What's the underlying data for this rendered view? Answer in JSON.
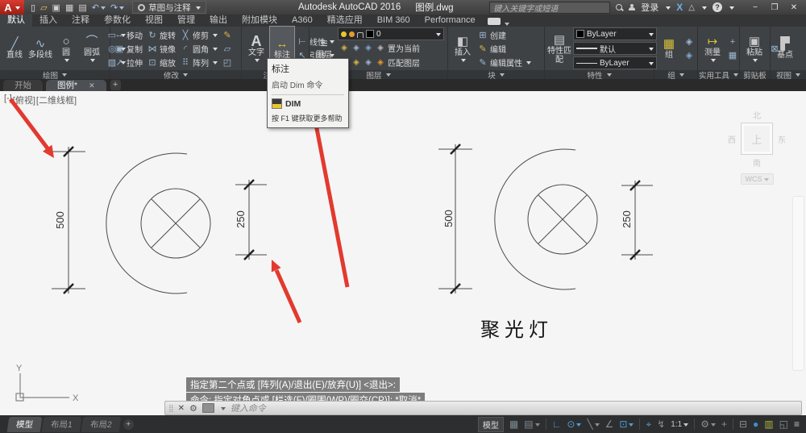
{
  "titlebar": {
    "app_letter": "A",
    "workspace": "草图与注释",
    "app_title": "Autodesk AutoCAD 2016",
    "doc_name": "图例.dwg",
    "search_placeholder": "键入关键字或短语",
    "sign_in": "登录",
    "exchange_x": "X",
    "help_q": "?",
    "minimize": "−",
    "maximize": "❐",
    "close": "✕",
    "qat": [
      {
        "name": "new-file-icon",
        "glyph": "▯",
        "color": "#e8e8e8"
      },
      {
        "name": "open-file-icon",
        "glyph": "▱",
        "color": "#e3c36a"
      },
      {
        "name": "save-icon",
        "glyph": "▣",
        "color": "#cfcfcf"
      },
      {
        "name": "save-as-icon",
        "glyph": "▦",
        "color": "#cfcfcf"
      },
      {
        "name": "plot-icon",
        "glyph": "▤",
        "color": "#cfcfcf"
      },
      {
        "name": "undo-icon",
        "glyph": "↶",
        "color": "#9fc3e8",
        "caret": true
      },
      {
        "name": "redo-icon",
        "glyph": "↷",
        "color": "#9fc3e8",
        "caret": true
      }
    ]
  },
  "ribbon": {
    "tabs": [
      {
        "label": "默认",
        "active": true
      },
      {
        "label": "插入"
      },
      {
        "label": "注释"
      },
      {
        "label": "参数化"
      },
      {
        "label": "视图"
      },
      {
        "label": "管理"
      },
      {
        "label": "输出"
      },
      {
        "label": "附加模块"
      },
      {
        "label": "A360"
      },
      {
        "label": "精选应用"
      },
      {
        "label": "BIM 360"
      },
      {
        "label": "Performance"
      }
    ],
    "icons": {
      "line": "╱",
      "polyline": "∿",
      "circle": "○",
      "arc": "⌒",
      "rect": "▭",
      "ellipse": "◎",
      "hatch": "▨",
      "move": "↔",
      "rotate": "↻",
      "trim": "╳",
      "copy": "▣",
      "mirror": "⋈",
      "fillet": "◜",
      "stretch": "↗",
      "scale": "⊡",
      "array": "⠿",
      "pencil": "✎",
      "box": "▱",
      "poly": "◰",
      "text": "A",
      "dim": "↔",
      "linear": "⊢",
      "leader": "↖",
      "layers": "≡",
      "layer_tool": "◈",
      "insert": "◧",
      "create": "⊞",
      "edit": "✎",
      "edit_attr": "✎",
      "match": "▤",
      "lines": "≡",
      "group": "▦",
      "group_small": "◈",
      "measure": "↦",
      "plus": "+",
      "calc": "▦",
      "paste": "▣",
      "cut": "⊠",
      "base": "▛"
    },
    "panels": {
      "draw": {
        "label": "绘图",
        "line": "直线",
        "polyline": "多段线",
        "circle": "圆",
        "arc": "圆弧"
      },
      "modify": {
        "label": "修改",
        "move": "移动",
        "rotate": "旋转",
        "trim": "修剪",
        "copy": "复制",
        "mirror": "镜像",
        "fillet": "圆角",
        "stretch": "拉伸",
        "scale": "缩放",
        "array": "阵列"
      },
      "annotate": {
        "label": "注释",
        "text": "文字",
        "dim": "标注",
        "linear": "线性",
        "leader": "引线"
      },
      "layers": {
        "label": "图层",
        "layers_btn": "图层",
        "current_layer": "0",
        "set_current": "置为当前",
        "match_layer": "匹配图层"
      },
      "block": {
        "label": "块",
        "insert": "插入",
        "create": "创建",
        "edit": "编辑",
        "edit_attr": "编辑属性"
      },
      "properties": {
        "label": "特性",
        "match_props": "特性匹配",
        "color": "ByLayer",
        "lineweight": "默认",
        "linetype": "ByLayer"
      },
      "groups": {
        "label": "组",
        "group": "组"
      },
      "utilities": {
        "label": "实用工具",
        "measure": "测量"
      },
      "clipboard": {
        "label": "剪贴板",
        "paste": "粘贴"
      },
      "view": {
        "label": "视图",
        "base": "基点"
      }
    }
  },
  "tooltip": {
    "title": "标注",
    "subtitle": "启动 Dim 命令",
    "command": "DIM",
    "help": "按 F1 键获取更多帮助"
  },
  "file_tabs": {
    "start": "开始",
    "doc": "图例*",
    "close": "✕",
    "plus": "+"
  },
  "viewport": {
    "controls": [
      "[-]",
      "[俯视]",
      "[二维线框]"
    ],
    "viewcube": {
      "n": "北",
      "s": "南",
      "e": "东",
      "w": "西",
      "top": "上",
      "wcs": "WCS"
    }
  },
  "drawing": {
    "label": "聚光灯",
    "dim_left_height": "500",
    "dim_left_width": "250",
    "dim_right_height": "500",
    "dim_right_width": "250",
    "ucs_x": "X",
    "ucs_y": "Y",
    "line_color": "#4a4a4a",
    "arrow_color": "#e23a2e"
  },
  "command_line": {
    "history": [
      "指定第二个点或 [阵列(A)/退出(E)/放弃(U)] <退出>:",
      "命令: 指定对角点或 [栏选(F)/圈围(WP)/圈交(CP)]: *取消*"
    ],
    "placeholder": "键入命令"
  },
  "status_bar": {
    "layout_tabs": [
      {
        "label": "模型",
        "active": true
      },
      {
        "label": "布局1"
      },
      {
        "label": "布局2"
      }
    ],
    "plus": "+",
    "model_button": "模型",
    "icons": [
      {
        "name": "grid-icon",
        "glyph": "▦",
        "color": "#7f8b94"
      },
      {
        "name": "snap-mode-icon",
        "glyph": "▤",
        "color": "#7f8b94",
        "caret": true
      },
      {
        "name": "separator"
      },
      {
        "name": "ortho-icon",
        "glyph": "∟",
        "color": "#4f9fd8"
      },
      {
        "name": "polar-tracking-icon",
        "glyph": "⊙",
        "color": "#4f9fd8",
        "caret": true
      },
      {
        "name": "isodraft-icon",
        "glyph": "╲",
        "color": "#8a8f94",
        "caret": true
      },
      {
        "name": "otrack-icon",
        "glyph": "∠",
        "color": "#8a8f94"
      },
      {
        "name": "osnap-icon",
        "glyph": "⊡",
        "color": "#4f9fd8",
        "caret": true
      },
      {
        "name": "separator"
      },
      {
        "name": "annotation-visibility-icon",
        "glyph": "⌖",
        "color": "#4f9fd8"
      },
      {
        "name": "autoscale-icon",
        "glyph": "↯",
        "color": "#8a8f94"
      },
      {
        "name": "annotation-scale-label",
        "glyph": "1:1",
        "color": "#c8c8c8",
        "caret": true,
        "text": true
      },
      {
        "name": "separator"
      },
      {
        "name": "workspace-gear-icon",
        "glyph": "⚙",
        "color": "#8a8f94",
        "caret": true
      },
      {
        "name": "annotation-monitor-icon",
        "glyph": "+",
        "color": "#8a8f94"
      },
      {
        "name": "separator"
      },
      {
        "name": "quick-properties-icon",
        "glyph": "⊟",
        "color": "#8a8f94"
      },
      {
        "name": "isolate-objects-icon",
        "glyph": "●",
        "color": "#3f8fd0"
      },
      {
        "name": "graphics-performance-icon",
        "glyph": "▥",
        "color": "#b0b343"
      },
      {
        "name": "clean-screen-icon",
        "glyph": "◱",
        "color": "#8a8f94"
      },
      {
        "name": "customization-icon",
        "glyph": "≡",
        "color": "#c0c0c0"
      }
    ]
  }
}
